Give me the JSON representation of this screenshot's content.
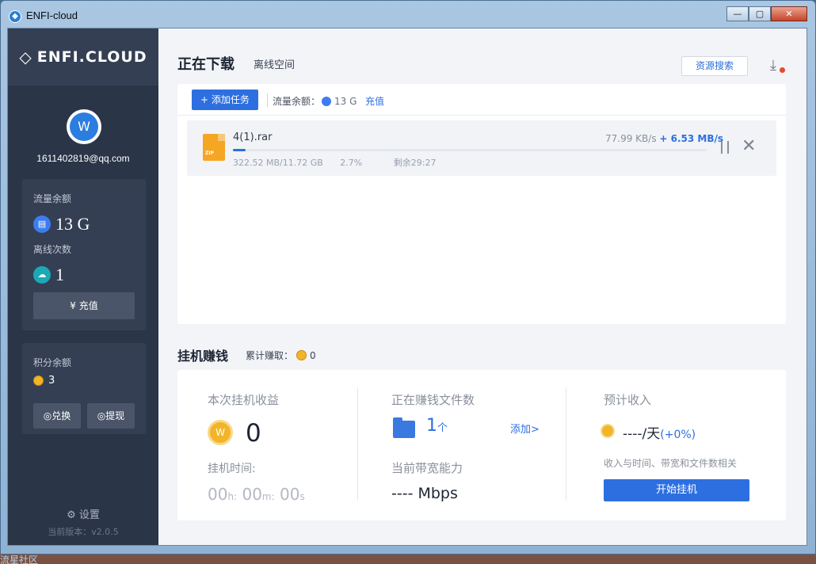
{
  "window": {
    "title": "ENFI-cloud",
    "min_label": "—",
    "max_label": "▢",
    "close_label": "✕"
  },
  "sidebar": {
    "logo": "ENFI.CLOUD",
    "logo_icon": "gem-icon",
    "email": "1611402819@qq.com",
    "flow_label": "流量余额",
    "flow_value": "13 G",
    "offline_label": "离线次数",
    "offline_value": "1",
    "recharge_label": "充值",
    "points_label": "积分余额",
    "points_value": "3",
    "exchange_label": "兑换",
    "withdraw_label": "提现",
    "settings_label": "设置",
    "version": "当前版本：v2.0.5"
  },
  "downloads": {
    "title": "正在下载",
    "subtitle": "离线空间",
    "search_label": "资源搜索",
    "add_task_label": "添加任务",
    "quota_label": "流量余额：",
    "quota_value": "13 G",
    "topup_label": "充值",
    "task": {
      "name": "4(1).rar",
      "file_badge": "ZIP",
      "size": "322.52 MB/11.72 GB",
      "percent": "2.7%",
      "progress": 0.027,
      "remaining": "剩余29:27",
      "speed_base": "77.99 KB/s",
      "speed_boost": "+ 6.53 MB/s"
    }
  },
  "earning": {
    "title": "挂机赚钱",
    "total_label": "累计赚取：",
    "total_value": "0",
    "income_label": "本次挂机收益",
    "income_value": "0",
    "time_label": "挂机时间:",
    "time_h": "00",
    "time_h_unit": "h:",
    "time_m": "00",
    "time_m_unit": "m:",
    "time_s": "00",
    "time_s_unit": "s",
    "files_label": "正在赚钱文件数",
    "files_value": "1",
    "files_unit": "个",
    "add_label": "添加>",
    "bandwidth_label": "当前带宽能力",
    "bandwidth_value": "---- Mbps",
    "estimate_label": "预计收入",
    "estimate_value": "----/天",
    "estimate_change": "(+0%)",
    "estimate_note": "收入与时间、带宽和文件数相关",
    "start_label": "开始挂机"
  },
  "taskbar": {
    "text": "流星社区"
  },
  "colors": {
    "accent": "#2d6fe0",
    "sidebar_bg": "#2b3548",
    "coin": "#f2b428"
  }
}
